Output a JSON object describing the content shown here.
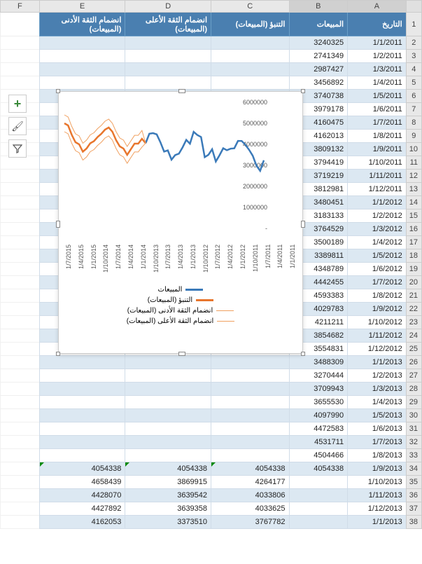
{
  "columns": [
    "A",
    "B",
    "C",
    "D",
    "E",
    "F"
  ],
  "headers": {
    "A": "التاريخ",
    "B": "المبيعات",
    "C": "التنبؤ (المبيعات)",
    "D": "انضمام الثقة الأعلى (المبيعات)",
    "E": "انضمام الثقة الأدنى (المبيعات)"
  },
  "rows": [
    {
      "n": 2,
      "A": "1/1/2011",
      "B": "3240325",
      "C": "",
      "D": "",
      "E": ""
    },
    {
      "n": 3,
      "A": "1/2/2011",
      "B": "2741349",
      "C": "",
      "D": "",
      "E": ""
    },
    {
      "n": 4,
      "A": "1/3/2011",
      "B": "2987427",
      "C": "",
      "D": "",
      "E": ""
    },
    {
      "n": 5,
      "A": "1/4/2011",
      "B": "3456892",
      "C": "",
      "D": "",
      "E": ""
    },
    {
      "n": 6,
      "A": "1/5/2011",
      "B": "3740738",
      "C": "",
      "D": "",
      "E": ""
    },
    {
      "n": 7,
      "A": "1/6/2011",
      "B": "3979178",
      "C": "",
      "D": "",
      "E": ""
    },
    {
      "n": 8,
      "A": "1/7/2011",
      "B": "4160475",
      "C": "",
      "D": "",
      "E": ""
    },
    {
      "n": 9,
      "A": "1/8/2011",
      "B": "4162013",
      "C": "",
      "D": "",
      "E": ""
    },
    {
      "n": 10,
      "A": "1/9/2011",
      "B": "3809132",
      "C": "",
      "D": "",
      "E": ""
    },
    {
      "n": 11,
      "A": "1/10/2011",
      "B": "3794419",
      "C": "",
      "D": "",
      "E": ""
    },
    {
      "n": 12,
      "A": "1/11/2011",
      "B": "3719219",
      "C": "",
      "D": "",
      "E": ""
    },
    {
      "n": 13,
      "A": "1/12/2011",
      "B": "3812981",
      "C": "",
      "D": "",
      "E": ""
    },
    {
      "n": 14,
      "A": "1/1/2012",
      "B": "3480451",
      "C": "",
      "D": "",
      "E": ""
    },
    {
      "n": 15,
      "A": "1/2/2012",
      "B": "3183133",
      "C": "",
      "D": "",
      "E": ""
    },
    {
      "n": 16,
      "A": "1/3/2012",
      "B": "3764529",
      "C": "",
      "D": "",
      "E": ""
    },
    {
      "n": 17,
      "A": "1/4/2012",
      "B": "3500189",
      "C": "",
      "D": "",
      "E": ""
    },
    {
      "n": 18,
      "A": "1/5/2012",
      "B": "3389811",
      "C": "",
      "D": "",
      "E": ""
    },
    {
      "n": 19,
      "A": "1/6/2012",
      "B": "4348789",
      "C": "",
      "D": "",
      "E": ""
    },
    {
      "n": 20,
      "A": "1/7/2012",
      "B": "4442455",
      "C": "",
      "D": "",
      "E": ""
    },
    {
      "n": 21,
      "A": "1/8/2012",
      "B": "4593383",
      "C": "",
      "D": "",
      "E": ""
    },
    {
      "n": 22,
      "A": "1/9/2012",
      "B": "4029783",
      "C": "",
      "D": "",
      "E": ""
    },
    {
      "n": 23,
      "A": "1/10/2012",
      "B": "4211211",
      "C": "",
      "D": "",
      "E": ""
    },
    {
      "n": 24,
      "A": "1/11/2012",
      "B": "3854682",
      "C": "",
      "D": "",
      "E": ""
    },
    {
      "n": 25,
      "A": "1/12/2012",
      "B": "3554831",
      "C": "",
      "D": "",
      "E": ""
    },
    {
      "n": 26,
      "A": "1/1/2013",
      "B": "3488309",
      "C": "",
      "D": "",
      "E": ""
    },
    {
      "n": 27,
      "A": "1/2/2013",
      "B": "3270444",
      "C": "",
      "D": "",
      "E": ""
    },
    {
      "n": 28,
      "A": "1/3/2013",
      "B": "3709943",
      "C": "",
      "D": "",
      "E": ""
    },
    {
      "n": 29,
      "A": "1/4/2013",
      "B": "3655530",
      "C": "",
      "D": "",
      "E": ""
    },
    {
      "n": 30,
      "A": "1/5/2013",
      "B": "4097990",
      "C": "",
      "D": "",
      "E": ""
    },
    {
      "n": 31,
      "A": "1/6/2013",
      "B": "4472583",
      "C": "",
      "D": "",
      "E": ""
    },
    {
      "n": 32,
      "A": "1/7/2013",
      "B": "4531711",
      "C": "",
      "D": "",
      "E": ""
    },
    {
      "n": 33,
      "A": "1/8/2013",
      "B": "4504466",
      "C": "",
      "D": "",
      "E": ""
    },
    {
      "n": 34,
      "A": "1/9/2013",
      "B": "4054338",
      "C": "4054338",
      "D": "4054338",
      "E": "4054338",
      "mark": true
    },
    {
      "n": 35,
      "A": "1/10/2013",
      "B": "",
      "C": "4264177",
      "D": "3869915",
      "E": "4658439"
    },
    {
      "n": 36,
      "A": "1/11/2013",
      "B": "",
      "C": "4033806",
      "D": "3639542",
      "E": "4428070"
    },
    {
      "n": 37,
      "A": "1/12/2013",
      "B": "",
      "C": "4033625",
      "D": "3639358",
      "E": "4427892"
    },
    {
      "n": 38,
      "A": "1/1/2013",
      "B": "",
      "C": "3767782",
      "D": "3373510",
      "E": "4162053"
    }
  ],
  "chart_data": {
    "type": "line",
    "xlabel": "",
    "ylabel": "",
    "ylim": [
      0,
      6000000
    ],
    "y_ticks": [
      1000000,
      2000000,
      3000000,
      4000000,
      5000000,
      6000000
    ],
    "x_ticks": [
      "1/1/2011",
      "1/4/2011",
      "1/7/2011",
      "1/10/2011",
      "1/1/2012",
      "1/4/2012",
      "1/7/2012",
      "1/10/2012",
      "1/1/2013",
      "1/4/2013",
      "1/7/2013",
      "1/10/2013",
      "1/1/2014",
      "1/4/2014",
      "1/7/2014",
      "1/10/2014",
      "1/1/2015",
      "1/4/2015",
      "1/7/2015"
    ],
    "series": [
      {
        "name": "المبيعات",
        "color": "#3b7ab9",
        "thick": true,
        "x": [
          0,
          1,
          2,
          3,
          4,
          5,
          6,
          7,
          8,
          9,
          10,
          11,
          12,
          13,
          14,
          15,
          16,
          17,
          18,
          19,
          20,
          21,
          22,
          23,
          24,
          25,
          26,
          27,
          28,
          29,
          30,
          31,
          32
        ],
        "y": [
          3240325,
          2741349,
          2987427,
          3456892,
          3740738,
          3979178,
          4160475,
          4162013,
          3809132,
          3794419,
          3719219,
          3812981,
          3480451,
          3183133,
          3764529,
          3500189,
          3389811,
          4348789,
          4442455,
          4593383,
          4029783,
          4211211,
          3854682,
          3554831,
          3488309,
          3270444,
          3709943,
          3655530,
          4097990,
          4472583,
          4531711,
          4504466,
          4054338
        ]
      },
      {
        "name": "التنبؤ (المبيعات)",
        "color": "#e8762d",
        "thick": true,
        "x": [
          32,
          33,
          34,
          35,
          36,
          37,
          38,
          39,
          40,
          41,
          42,
          43,
          44,
          45,
          46,
          47,
          48,
          49,
          50,
          51,
          52,
          53,
          54
        ],
        "y": [
          4054338,
          4264177,
          4033806,
          4033625,
          3767782,
          3500000,
          3800000,
          3900000,
          4200000,
          4600000,
          4800000,
          4700000,
          4500000,
          4350000,
          4150000,
          4050000,
          3800000,
          3650000,
          4000000,
          4100000,
          4450000,
          4900000,
          5000000
        ]
      },
      {
        "name": "انضمام الثقة الأدنى (المبيعات)",
        "color": "#f0a060",
        "thick": false,
        "x": [
          32,
          33,
          34,
          35,
          36,
          37,
          38,
          39,
          40,
          41,
          42,
          43,
          44,
          45,
          46,
          47,
          48,
          49,
          50,
          51,
          52,
          53,
          54
        ],
        "y": [
          4054338,
          3869915,
          3639542,
          3639358,
          3373510,
          3100000,
          3400000,
          3500000,
          3800000,
          4200000,
          4400000,
          4300000,
          4100000,
          3950000,
          3750000,
          3650000,
          3400000,
          3250000,
          3600000,
          3700000,
          4050000,
          4500000,
          4600000
        ]
      },
      {
        "name": "انضمام الثقة الأعلى (المبيعات)",
        "color": "#f0a060",
        "thick": false,
        "x": [
          32,
          33,
          34,
          35,
          36,
          37,
          38,
          39,
          40,
          41,
          42,
          43,
          44,
          45,
          46,
          47,
          48,
          49,
          50,
          51,
          52,
          53,
          54
        ],
        "y": [
          4054338,
          4658439,
          4428070,
          4427892,
          4162053,
          3900000,
          4200000,
          4300000,
          4600000,
          5000000,
          5200000,
          5100000,
          4900000,
          4750000,
          4550000,
          4450000,
          4200000,
          4050000,
          4400000,
          4500000,
          4850000,
          5300000,
          5400000
        ]
      }
    ]
  },
  "legend": [
    {
      "label": "المبيعات",
      "color": "#3b7ab9",
      "h": 3
    },
    {
      "label": "التنبؤ (المبيعات)",
      "color": "#e8762d",
      "h": 3
    },
    {
      "label": "انضمام الثقة الأدنى (المبيعات)",
      "color": "#f0a060",
      "h": 1
    },
    {
      "label": "انضمام الثقة الأعلى (المبيعات)",
      "color": "#f0a060",
      "h": 1
    }
  ],
  "toolbar": {
    "plus": "+",
    "brush": "🖌",
    "filter": "▼"
  }
}
